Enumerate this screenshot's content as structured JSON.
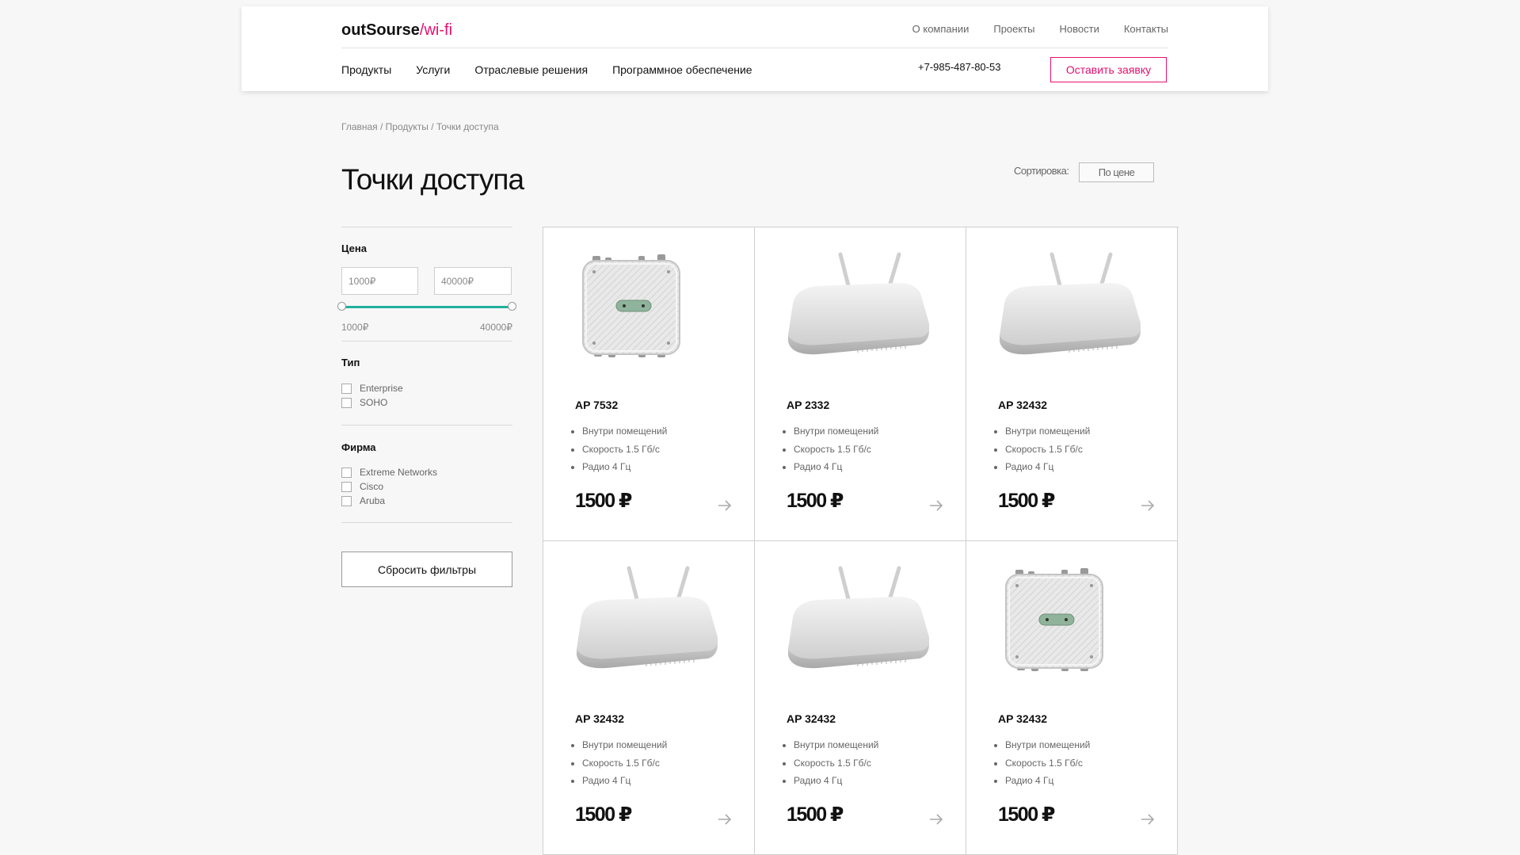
{
  "header": {
    "logo_main": "outSourse",
    "logo_accent": "/wi-fi",
    "top_links": [
      "О компании",
      "Проекты",
      "Новости",
      "Контакты"
    ],
    "nav": [
      "Продукты",
      "Услуги",
      "Отраслевые решения",
      "Программное обеспечение"
    ],
    "phone": "+7-985-487-80-53",
    "cta_label": "Оставить заявку"
  },
  "breadcrumb": "Главная / Продукты / Точки доступа",
  "page_title": "Точки доступа",
  "sort": {
    "label": "Сортировка:",
    "value": "По цене"
  },
  "filters": {
    "price_heading": "Цена",
    "price_min": "1000₽",
    "price_max": "40000₽",
    "range_min_label": "1000₽",
    "range_max_label": "40000₽",
    "type_heading": "Тип",
    "types": [
      "Enterprise",
      "SOHO"
    ],
    "brand_heading": "Фирма",
    "brands": [
      "Extreme Networks",
      "Cisco",
      "Aruba"
    ],
    "reset_label": "Сбросить фильтры"
  },
  "products": [
    {
      "name": "AP 7532",
      "image": "outdoor-ap",
      "features": [
        "Внутри помещений",
        "Скорость 1.5 Гб/с",
        "Радио 4 Гц"
      ],
      "price": "1500 ₽"
    },
    {
      "name": "AP 2332",
      "image": "indoor-ap",
      "features": [
        "Внутри помещений",
        "Скорость 1.5 Гб/с",
        "Радио 4 Гц"
      ],
      "price": "1500 ₽"
    },
    {
      "name": "AP 32432",
      "image": "indoor-ap",
      "features": [
        "Внутри помещений",
        "Скорость 1.5 Гб/с",
        "Радио 4 Гц"
      ],
      "price": "1500 ₽"
    },
    {
      "name": "AP 32432",
      "image": "indoor-ap",
      "features": [
        "Внутри помещений",
        "Скорость 1.5 Гб/с",
        "Радио 4 Гц"
      ],
      "price": "1500 ₽"
    },
    {
      "name": "AP 32432",
      "image": "indoor-ap",
      "features": [
        "Внутри помещений",
        "Скорость 1.5 Гб/с",
        "Радио 4 Гц"
      ],
      "price": "1500 ₽"
    },
    {
      "name": "AP 32432",
      "image": "outdoor-ap",
      "features": [
        "Внутри помещений",
        "Скорость 1.5 Гб/с",
        "Радио 4 Гц"
      ],
      "price": "1500 ₽"
    }
  ],
  "colors": {
    "accent": "#e6106f",
    "slider": "#21b09b"
  }
}
